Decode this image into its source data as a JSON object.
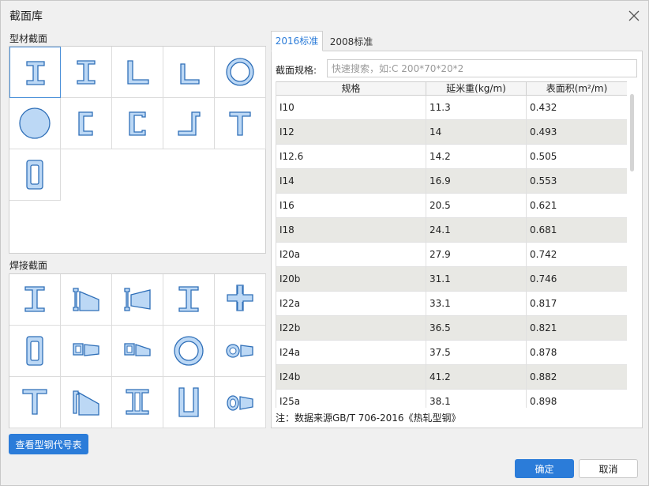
{
  "dialog": {
    "title": "截面库"
  },
  "sections": {
    "profile_label": "型材截面",
    "welded_label": "焊接截面",
    "profile_icons": [
      "i-beam-icon",
      "h-beam-icon",
      "unequal-angle-icon",
      "equal-angle-icon",
      "round-tube-icon",
      "round-bar-icon",
      "bracket-channel-icon",
      "channel-icon",
      "z-section-icon",
      "t-section-icon",
      "rect-tube-icon"
    ],
    "welded_icons": [
      "welded-i-beam-icon",
      "tapered-i-beam-icon",
      "tapered-i-beam-reverse-icon",
      "welded-h-beam-icon",
      "cross-section-icon",
      "welded-box-icon",
      "tapered-box-icon",
      "tapered-box-reverse-icon",
      "welded-circle-tube-icon",
      "tapered-circle-icon",
      "welded-t-section-icon",
      "tapered-t-section-icon",
      "double-channel-icon",
      "u-channel-icon",
      "tapered-round-icon"
    ]
  },
  "buttons": {
    "view_codes": "查看型钢代号表",
    "ok": "确定",
    "cancel": "取消"
  },
  "tabs": [
    {
      "label": "2016标准",
      "active": true
    },
    {
      "label": "2008标准",
      "active": false
    }
  ],
  "search": {
    "label": "截面规格:",
    "placeholder": "快速搜索，如:C 200*70*20*2"
  },
  "table": {
    "columns": [
      "规格",
      "延米重(kg/m)",
      "表面积(m²/m)"
    ],
    "rows": [
      [
        "I10",
        "11.3",
        "0.432"
      ],
      [
        "I12",
        "14",
        "0.493"
      ],
      [
        "I12.6",
        "14.2",
        "0.505"
      ],
      [
        "I14",
        "16.9",
        "0.553"
      ],
      [
        "I16",
        "20.5",
        "0.621"
      ],
      [
        "I18",
        "24.1",
        "0.681"
      ],
      [
        "I20a",
        "27.9",
        "0.742"
      ],
      [
        "I20b",
        "31.1",
        "0.746"
      ],
      [
        "I22a",
        "33.1",
        "0.817"
      ],
      [
        "I22b",
        "36.5",
        "0.821"
      ],
      [
        "I24a",
        "37.5",
        "0.878"
      ],
      [
        "I24b",
        "41.2",
        "0.882"
      ],
      [
        "I25a",
        "38.1",
        "0.898"
      ]
    ]
  },
  "note": "注：数据来源GB/T 706-2016《热轧型钢》",
  "colors": {
    "accent": "#2b7cd9",
    "shape_fill": "#bcd8f5",
    "shape_stroke": "#2f6fb8",
    "alt_row": "#e8e8e4"
  }
}
